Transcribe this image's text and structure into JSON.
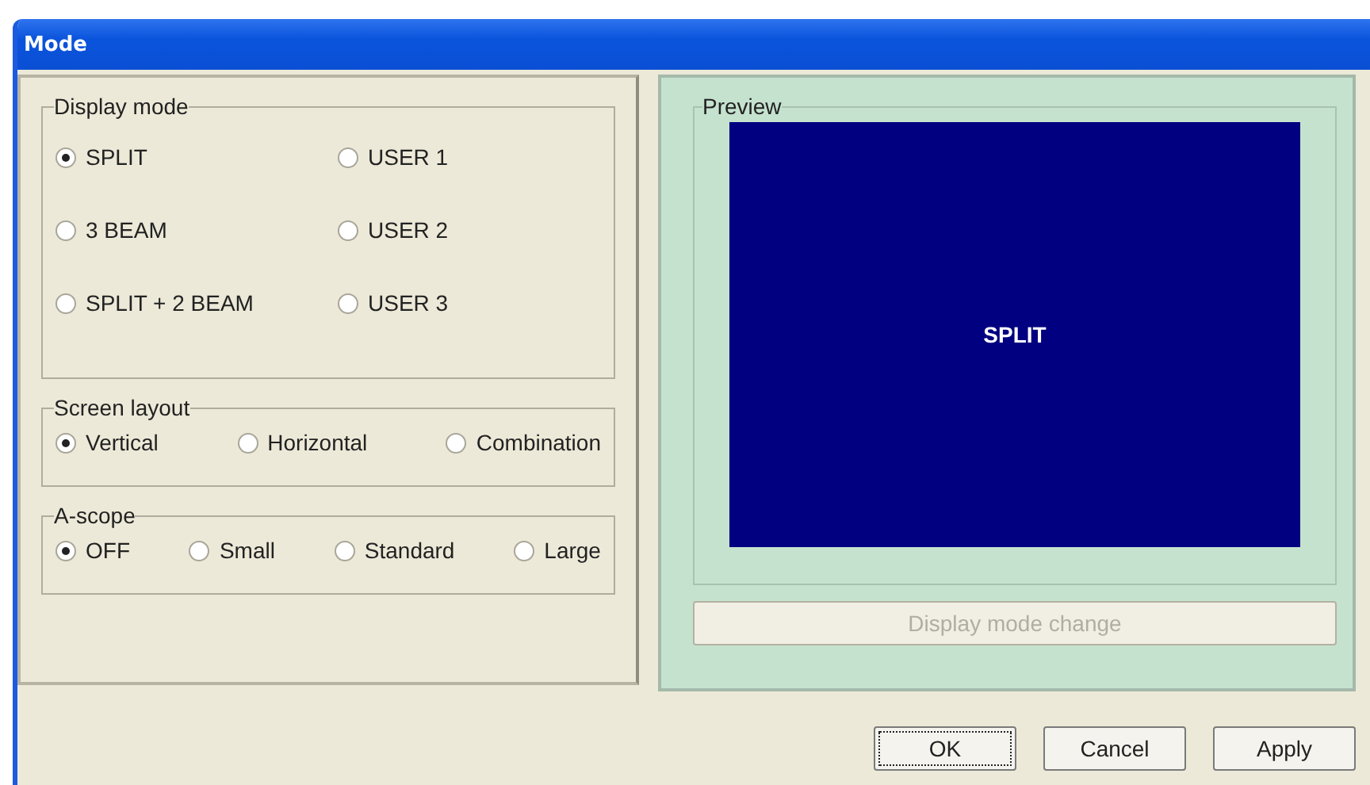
{
  "window": {
    "title": "Mode"
  },
  "groups": [
    {
      "title": "Display mode",
      "kind": "grid",
      "options": [
        {
          "label": "SPLIT",
          "selected": true
        },
        {
          "label": "USER 1",
          "selected": false
        },
        {
          "label": "3 BEAM",
          "selected": false
        },
        {
          "label": "USER 2",
          "selected": false
        },
        {
          "label": "SPLIT + 2 BEAM",
          "selected": false
        },
        {
          "label": "USER 3",
          "selected": false
        }
      ]
    },
    {
      "title": "Screen layout",
      "kind": "row",
      "options": [
        {
          "label": "Vertical",
          "selected": true
        },
        {
          "label": "Horizontal",
          "selected": false
        },
        {
          "label": "Combination",
          "selected": false
        }
      ]
    },
    {
      "title": "A-scope",
      "kind": "row",
      "options": [
        {
          "label": "OFF",
          "selected": true
        },
        {
          "label": "Small",
          "selected": false
        },
        {
          "label": "Standard",
          "selected": false
        },
        {
          "label": "Large",
          "selected": false
        }
      ]
    }
  ],
  "preview": {
    "title": "Preview",
    "screen_label": "SPLIT"
  },
  "change_button": {
    "label": "Display mode change",
    "disabled": true
  },
  "buttons": [
    {
      "label": "OK",
      "focused": true
    },
    {
      "label": "Cancel",
      "focused": false
    },
    {
      "label": "Apply",
      "focused": false
    }
  ]
}
